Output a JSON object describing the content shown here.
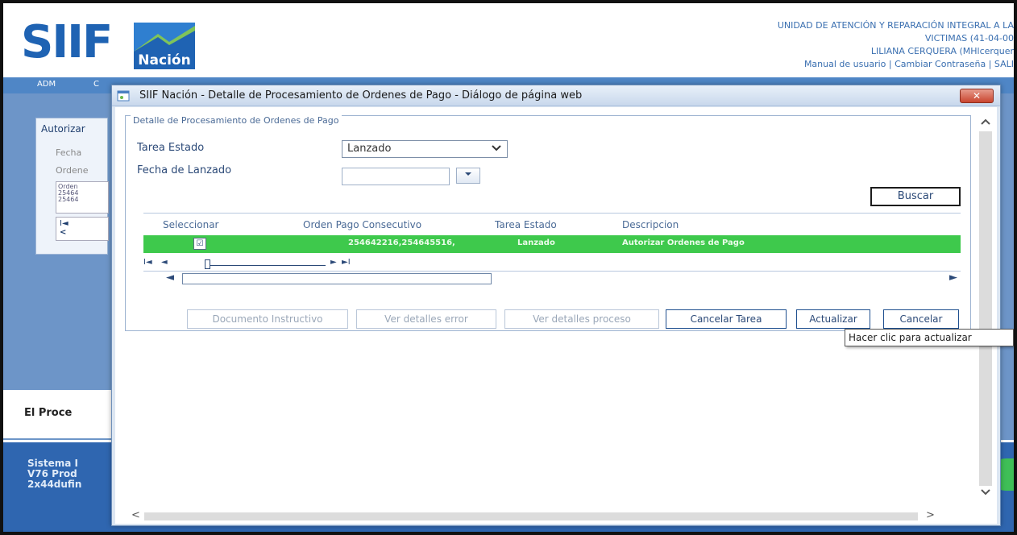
{
  "app": {
    "logo_text": "SIIF",
    "logo_sub": "Nación",
    "header_org_line1": "UNIDAD DE ATENCIÓN Y REPARACIÓN INTEGRAL A LA",
    "header_org_line2": "VICTIMAS (41-04-00",
    "header_user": "LILIANA CERQUERA (MHlcerquer",
    "links": {
      "manual": "Manual de usuario",
      "sep1": " | ",
      "cambiar": "Cambiar Contraseña",
      "sep2": " | ",
      "salir": "SALI"
    },
    "nav": {
      "item1": "ADM",
      "item2": "C"
    },
    "left_panel": {
      "title": "Autorizar",
      "label_fecha": "Fecha",
      "label_ordenes": "Ordene",
      "mini_table": "Orden\n25464\n25464",
      "mini_pager_first": "I◄",
      "mini_pager_prev": "<"
    },
    "process_label": "El Proce",
    "footer_line1": "Sistema I",
    "footer_line2": "V76 Prod",
    "footer_line3": "2x44dufin"
  },
  "dialog": {
    "title": "SIIF Nación - Detalle de Procesamiento de Ordenes de Pago - Diálogo de página web",
    "close_label": "✕",
    "legend": "Detalle de Procesamiento de Ordenes de Pago",
    "tarea_estado_label": "Tarea Estado",
    "tarea_estado_value": "Lanzado",
    "fecha_lanzado_label": "Fecha de Lanzado",
    "fecha_lanzado_value": "",
    "buscar_label": "Buscar",
    "grid": {
      "columns": [
        "Seleccionar",
        "Orden Pago Consecutivo",
        "Tarea Estado",
        "Descripcion"
      ],
      "rows": [
        {
          "selected": "☑",
          "orden": "254642216,254645516,",
          "estado": "Lanzado",
          "descripcion": "Autorizar Ordenes de Pago"
        }
      ]
    },
    "pager": {
      "first": "I◄",
      "prev": "◄",
      "next": "►",
      "last": "►I"
    },
    "buttons": {
      "documento": "Documento Instructivo",
      "ver_error": "Ver detalles error",
      "ver_proceso": "Ver detalles proceso",
      "cancelar_tarea": "Cancelar Tarea",
      "actualizar": "Actualizar",
      "cancelar": "Cancelar"
    },
    "tooltip": "Hacer clic para actualizar"
  },
  "colors": {
    "brand_blue": "#1f63b3",
    "selected_row_green": "#3ec94c",
    "close_red": "#c9452f"
  }
}
